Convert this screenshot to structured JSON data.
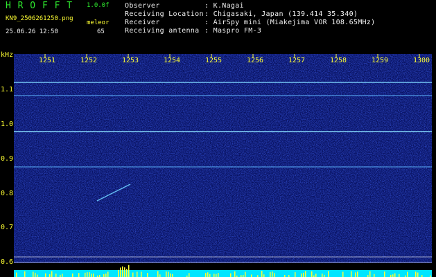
{
  "header": {
    "app_title": "H R O F F T",
    "version": "1.0.0f",
    "filename": "KN9_2506261250.png",
    "datetime": "25.06.26 12:50",
    "meleor_label": "meleor",
    "meleor_count": "65"
  },
  "info": [
    {
      "label": "Observer",
      "value": ": K.Nagai"
    },
    {
      "label": "Receiving Location",
      "value": ": Chigasaki, Japan (139.414 35.340)"
    },
    {
      "label": "Receiver",
      "value": ": AirSpy mini (Miakejima VOR 108.65MHz)"
    },
    {
      "label": "Receiving antenna",
      "value": ": Maspro FM-3"
    }
  ],
  "axes": {
    "y_unit": "kHz",
    "x_ticks": [
      "1251",
      "1252",
      "1253",
      "1254",
      "1255",
      "1256",
      "1257",
      "1258",
      "1259",
      "1300"
    ],
    "y_ticks": [
      "1.1",
      "1.0",
      "0.9",
      "0.8",
      "0.7",
      "0.6"
    ]
  },
  "colors": {
    "background": "#000000",
    "spectrum": "#0a1a8c",
    "header_green": "#2ee82e",
    "tick_yellow": "#ffff33",
    "signal_line": "#7fd6ff",
    "baseline_cyan": "#00e5ff"
  }
}
